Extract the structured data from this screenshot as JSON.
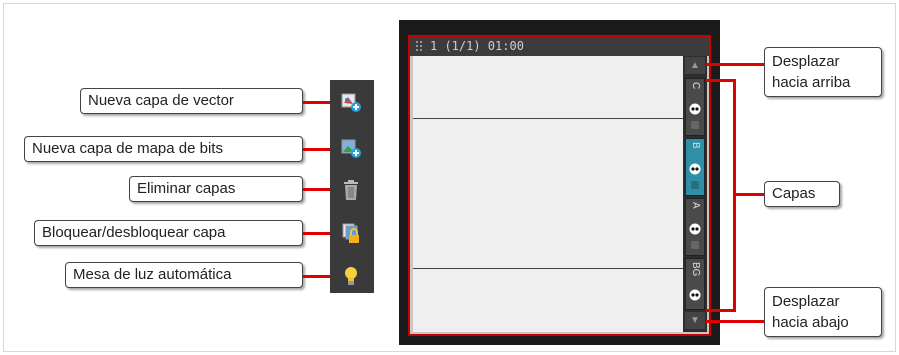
{
  "callouts": {
    "new_vector": "Nueva capa de vector",
    "new_bitmap": "Nueva capa de mapa de bits",
    "delete": "Eliminar capas",
    "lock": "Bloquear/desbloquear capa",
    "lightbox": "Mesa de luz automática",
    "scroll_up": [
      "Desplazar",
      "hacia arriba"
    ],
    "layers": "Capas",
    "scroll_down": [
      "Desplazar",
      "hacia abajo"
    ]
  },
  "panel": {
    "title": "1 (1/1) 01:00",
    "layers": [
      {
        "name": "C",
        "active": false
      },
      {
        "name": "B",
        "active": true
      },
      {
        "name": "A",
        "active": false
      },
      {
        "name": "BG",
        "active": false
      }
    ]
  },
  "icons": [
    "new-vector-layer-icon",
    "new-bitmap-layer-icon",
    "trash-icon",
    "lock-layer-icon",
    "lightbulb-icon"
  ],
  "colors": {
    "callout_line": "#e00000",
    "active_layer": "#2e8fa6",
    "panel_bg": "#1b1b1b"
  }
}
